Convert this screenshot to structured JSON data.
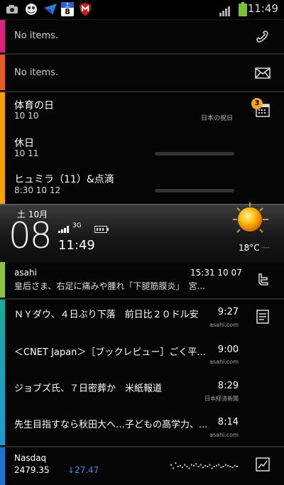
{
  "status": {
    "time": "11:49",
    "notifications": [
      "camera-icon",
      "pet-app-icon",
      "messaging-app-icon",
      "calendar-day-icon",
      "mcafee-icon"
    ],
    "calendar_badge": "8",
    "calendar_header": "土"
  },
  "calls": {
    "empty_text": "No items."
  },
  "messages": {
    "empty_text": "No items."
  },
  "calendar": {
    "badge": "3",
    "events": [
      {
        "title": "体育の日",
        "date": "10 10",
        "source": "日本の祝日"
      },
      {
        "title": "休日",
        "date": "10 11",
        "source": ""
      },
      {
        "title": "ヒュミラ（11）&点滴",
        "date": "8:30 10 12",
        "source": ""
      }
    ]
  },
  "clock": {
    "date": "土 10月",
    "day": "08",
    "network": "3G",
    "time": "11:49",
    "temperature": "18°C",
    "temp_extra": "----"
  },
  "twitter": {
    "user": "asahi",
    "timestamp": "15:31 10 07",
    "text": "皇后さま、右足に痛みや腫れ「下腿筋膜炎」　宮..."
  },
  "news": {
    "items": [
      {
        "title": "ＮＹダウ、４日ぶり下落　前日比２０ドル安",
        "time": "9:27",
        "source": "asahi.com"
      },
      {
        "title": "＜CNET Japan＞［ブックレビュー］ごく平...",
        "time": "9:00",
        "source": "asahi.com"
      },
      {
        "title": "ジョブズ氏、７日密葬か　米紙報道",
        "time": "8:29",
        "source": "日本経済新聞"
      },
      {
        "title": "先生目指すなら秋田大へ…子どもの高学力、...",
        "time": "8:14",
        "source": "asahi.com"
      }
    ]
  },
  "stocks": {
    "name": "Nasdaq",
    "value": "2479.35",
    "change": "↓27.47",
    "sparkline": [
      0.6,
      0.4,
      0.7,
      0.5,
      0.55,
      0.45,
      0.6,
      0.5,
      0.4,
      0.6,
      0.55,
      0.65,
      0.5,
      0.6,
      0.45,
      0.55,
      0.5,
      0.6,
      0.4,
      0.5,
      0.55,
      0.6,
      0.45,
      0.5,
      0.6,
      0.55,
      0.5,
      0.45,
      0.55,
      0.5
    ]
  },
  "colors": {
    "calls_bar": "#d6237b",
    "messages_bar": "#e45f28",
    "calendar_bar": "#f4a300",
    "twitter_bar": "#8cc63f",
    "news_bar_top": "#1aa89a",
    "news_bar_bottom": "#1f9bd1",
    "stocks_bar": "#1e72c8",
    "badge": "#f5a623",
    "stock_down": "#3b8ee8"
  }
}
